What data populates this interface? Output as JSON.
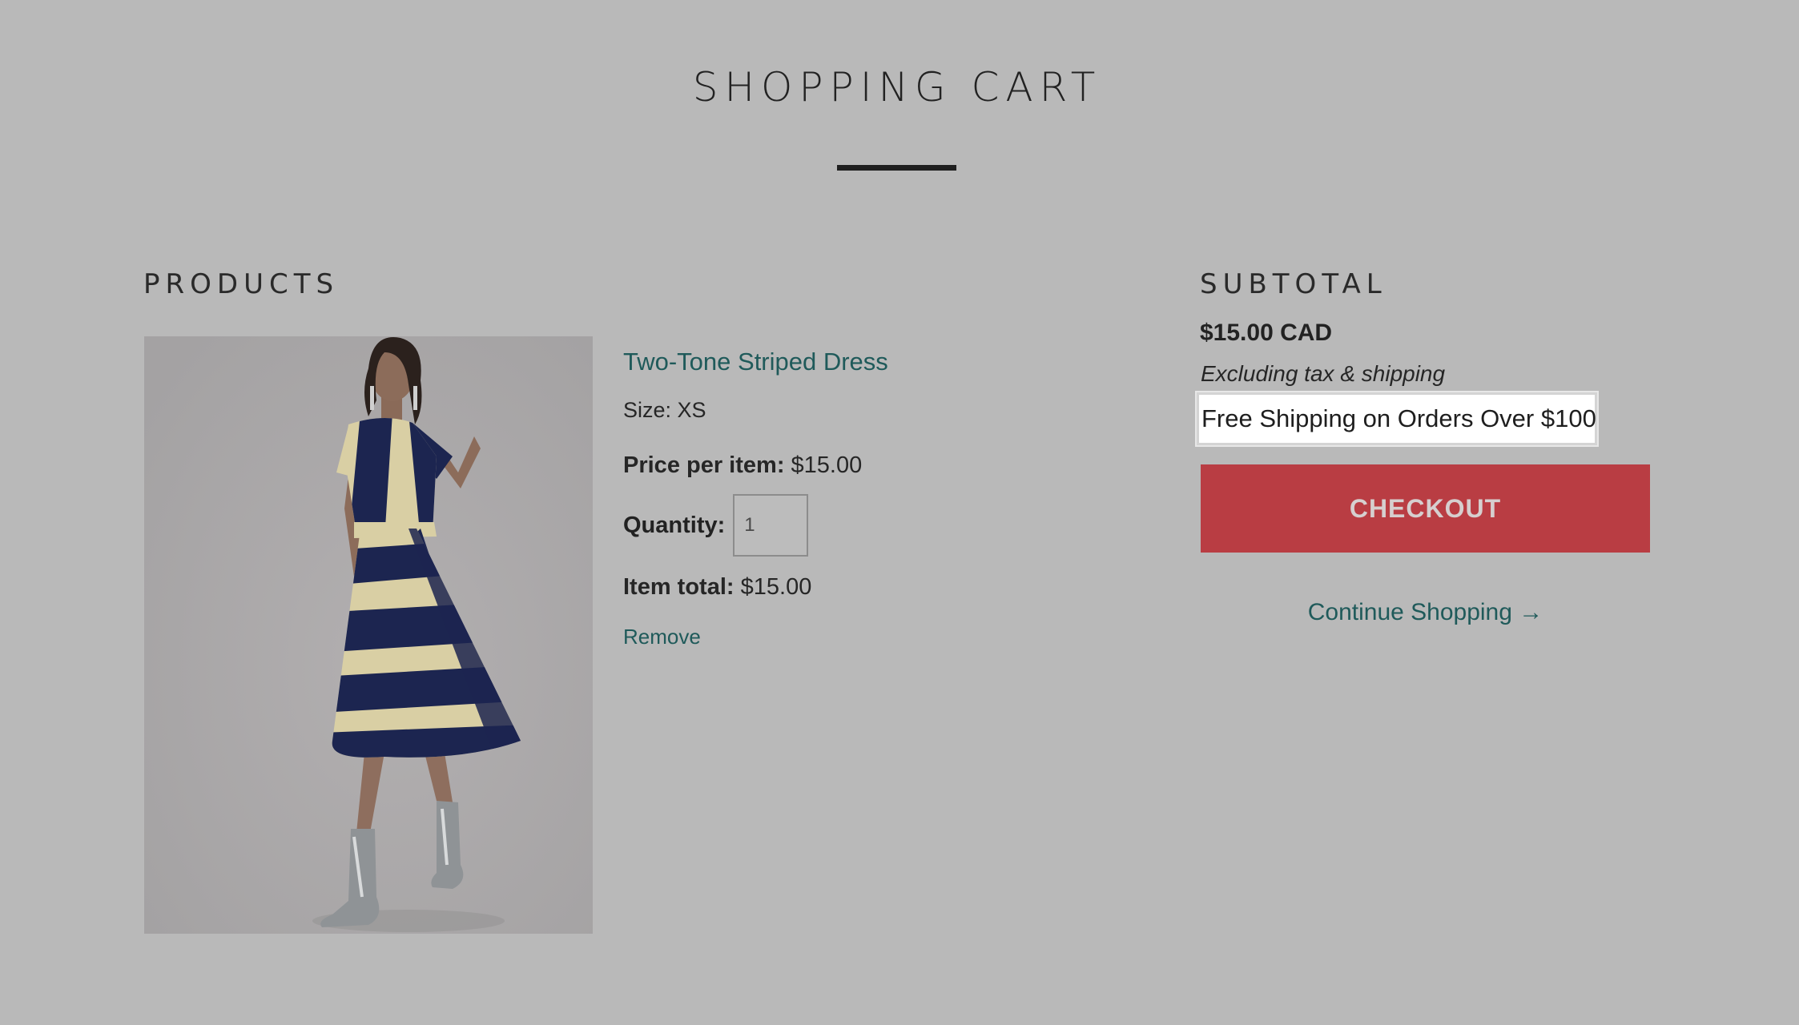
{
  "page": {
    "title": "SHOPPING CART"
  },
  "products_section": {
    "heading": "PRODUCTS",
    "item": {
      "name": "Two-Tone Striped Dress",
      "size_label": "Size:",
      "size_value": "XS",
      "price_label": "Price per item:",
      "price_value": "$15.00",
      "quantity_label": "Quantity:",
      "quantity_value": "1",
      "total_label": "Item total:",
      "total_value": "$15.00",
      "remove_label": "Remove",
      "image_alt": "two-tone-striped-dress-photo"
    }
  },
  "subtotal_section": {
    "heading": "SUBTOTAL",
    "amount": "$15.00 CAD",
    "tax_note": "Excluding tax & shipping",
    "shipping_banner": "Free Shipping on Orders Over $100",
    "checkout_label": "CHECKOUT",
    "continue_label": "Continue Shopping →"
  },
  "colors": {
    "background": "#b9b9b9",
    "link": "#1f5a5a",
    "checkout": "#b93d43",
    "dress_navy": "#1c2550",
    "dress_cream": "#d9cfa4"
  }
}
